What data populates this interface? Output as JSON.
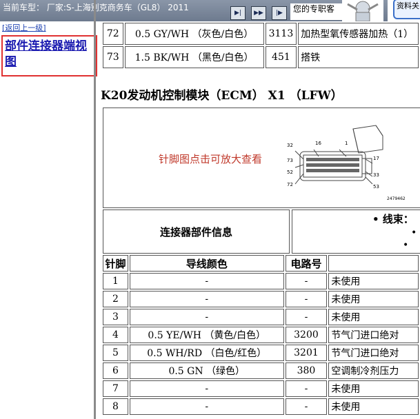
{
  "topbar": {
    "car_label": "当前车型： 厂家:S-上海别克商务车（GL8） 2011",
    "expert_label": "您的专职客",
    "doc_label": "资料关"
  },
  "sidebar": {
    "back_link": "[返回上一级]",
    "connector_link": "部件连接器端视图"
  },
  "top_rows": [
    {
      "pin": "72",
      "color": "0.5 GY/WH （灰色/白色）",
      "circuit": "3113",
      "func": "加热型氧传感器加热（1）"
    },
    {
      "pin": "73",
      "color": "1.5 BK/WH （黑色/白色）",
      "circuit": "451",
      "func": "搭铁"
    }
  ],
  "heading": "K20发动机控制模块（ECM） X1 （LFW）",
  "diagram": {
    "zoom_text": "针脚图点击可放大查看",
    "pin_labels": [
      "32",
      "16",
      "1",
      "73",
      "17",
      "52",
      "33",
      "72",
      "53"
    ],
    "part_no": "2479462"
  },
  "info": {
    "label": "连接器部件信息",
    "wire_label": "• 线束："
  },
  "pin_table": {
    "headers": [
      "针脚",
      "导线颜色",
      "电路号",
      ""
    ],
    "rows": [
      {
        "pin": "1",
        "color": "-",
        "circuit": "-",
        "func": "未使用"
      },
      {
        "pin": "2",
        "color": "-",
        "circuit": "-",
        "func": "未使用"
      },
      {
        "pin": "3",
        "color": "-",
        "circuit": "-",
        "func": "未使用"
      },
      {
        "pin": "4",
        "color": "0.5 YE/WH （黄色/白色）",
        "circuit": "3200",
        "func": "节气门进口绝对"
      },
      {
        "pin": "5",
        "color": "0.5 WH/RD （白色/红色）",
        "circuit": "3201",
        "func": "节气门进口绝对"
      },
      {
        "pin": "6",
        "color": "0.5 GN （绿色）",
        "circuit": "380",
        "func": "空调制冷剂压力"
      },
      {
        "pin": "7",
        "color": "-",
        "circuit": "-",
        "func": "未使用"
      },
      {
        "pin": "8",
        "color": "-",
        "circuit": "-",
        "func": "未使用"
      }
    ]
  },
  "colors": {
    "link": "#1a1ab0",
    "highlight_border": "#e03030",
    "zoom_text": "#c0392b"
  }
}
